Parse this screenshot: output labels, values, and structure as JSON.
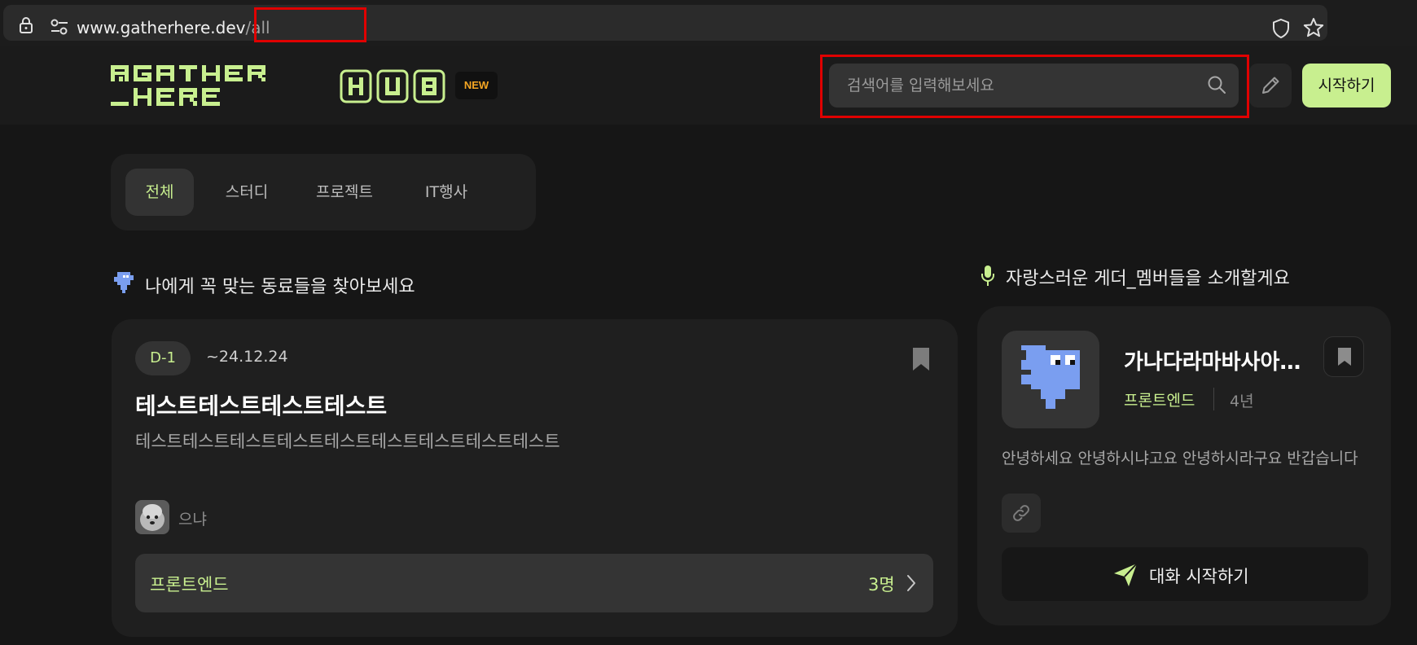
{
  "browser": {
    "url_domain": "www.gatherhere.dev",
    "url_path": "/all"
  },
  "header": {
    "new_badge": "NEW",
    "search_placeholder": "검색어를 입력해보세요",
    "start_label": "시작하기"
  },
  "tabs": [
    {
      "label": "전체",
      "active": true
    },
    {
      "label": "스터디",
      "active": false
    },
    {
      "label": "프로젝트",
      "active": false
    },
    {
      "label": "IT행사",
      "active": false
    }
  ],
  "sections": {
    "left_title": "나에게 꼭 맞는 동료들을 찾아보세요",
    "right_title": "자랑스러운 게더_멤버들을 소개할게요"
  },
  "post": {
    "dday": "D-1",
    "deadline": "~24.12.24",
    "title": "테스트테스트테스트테스트",
    "description": "테스트테스트테스트테스트테스트테스트테스트테스트테스트",
    "author": "으냐",
    "role": "프론트엔드",
    "count": "3명"
  },
  "member": {
    "name": "가나다라마바사아자차카타파하",
    "role": "프론트엔드",
    "years": "4년",
    "intro": "안녕하세요 안녕하시냐고요 안녕하시라구요 반갑습니다",
    "chat_label": "대화 시작하기"
  },
  "colors": {
    "accent": "#c8ef8f",
    "background": "#161616",
    "card": "#1f1f1f",
    "new_badge": "#f5a623",
    "highlight": "#e00000",
    "mascot": "#7a9ef0"
  },
  "icons": [
    "lock-icon",
    "tune-icon",
    "shield-icon",
    "star-icon",
    "search-icon",
    "pencil-icon",
    "bookmark-icon",
    "chevron-right-icon",
    "link-icon",
    "send-icon",
    "microphone-icon",
    "mascot-icon"
  ]
}
